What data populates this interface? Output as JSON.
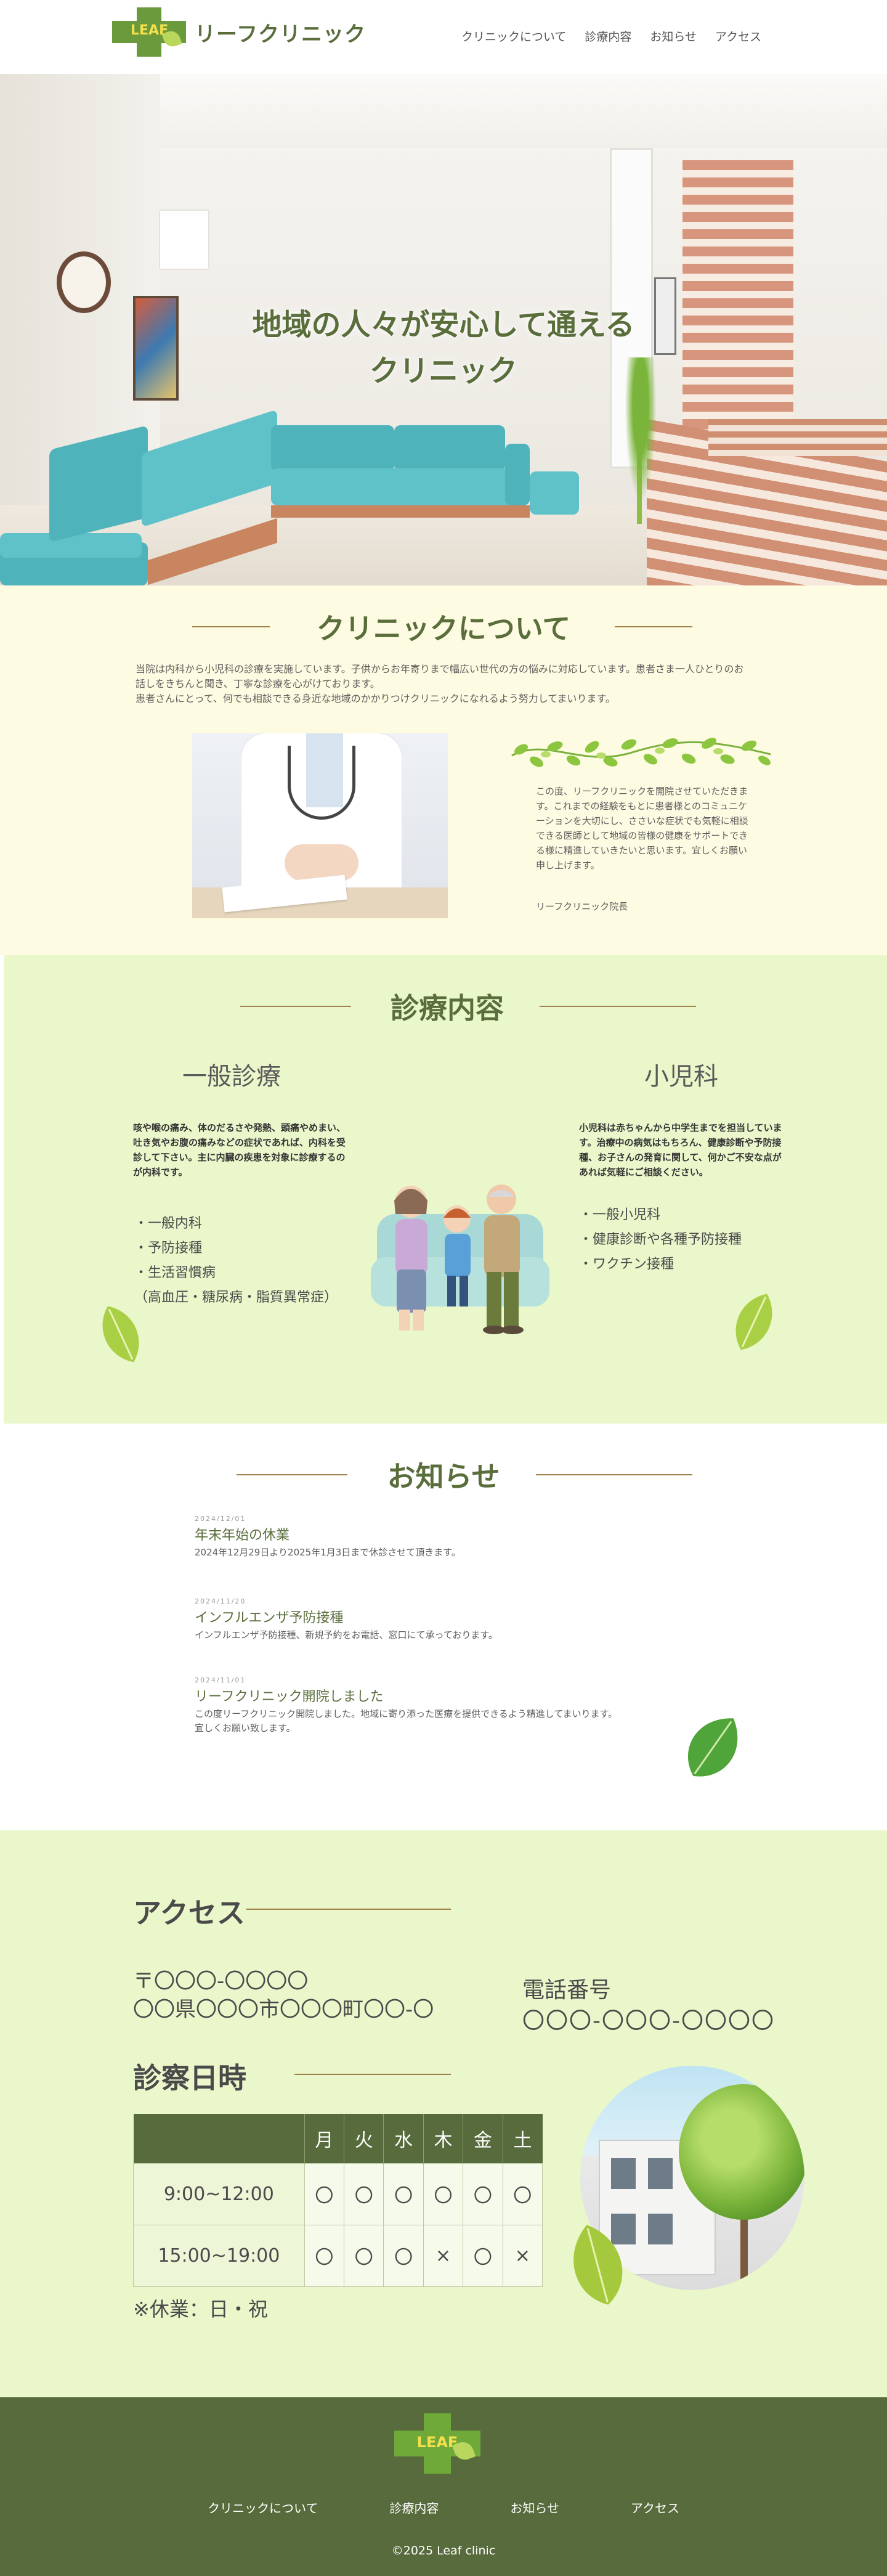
{
  "header": {
    "logo_mark": "LEAF",
    "brand": "リーフクリニック",
    "nav": [
      "クリニックについて",
      "診療内容",
      "お知らせ",
      "アクセス"
    ]
  },
  "hero": {
    "title_line1": "地域の人々が安心して通える",
    "title_line2": "クリニック"
  },
  "about": {
    "title": "クリニックについて",
    "lead": "当院は内科から小児科の診療を実施しています。子供からお年寄りまで幅広い世代の方の悩みに対応しています。患者さま一人ひとりのお話しをきちんと聞き、丁寧な診療を心がけております。\n患者さんにとって、何でも相談できる身近な地域のかかりつけクリニックになれるよう努力してまいります。",
    "greeting": "この度、リーフクリニックを開院させていただきます。これまでの経験をもとに患者様とのコミュニケーションを大切にし、ささいな症状でも気軽に相談できる医師として地域の皆様の健康をサポートできる様に精進していきたいと思います。宜しくお願い申し上げます。",
    "signature": "リーフクリニック院長"
  },
  "services": {
    "title": "診療内容",
    "general": {
      "heading": "一般診療",
      "description": "咳や喉の痛み、体のだるさや発熱、頭痛やめまい、吐き気やお腹の痛みなどの症状であれば、内科を受診して下さい。主に内臓の疾患を対象に診療するのが内科です。",
      "items": [
        "・一般内科",
        "・予防接種",
        "・生活習慣病",
        "（高血圧・糖尿病・脂質異常症）"
      ]
    },
    "pediatrics": {
      "heading": "小児科",
      "description": "小児科は赤ちゃんから中学生までを担当しています。治療中の病気はもちろん、健康診断や予防接種、お子さんの発育に関して、何かご不安な点があれば気軽にご相談ください。",
      "items": [
        "・一般小児科",
        "・健康診断や各種予防接種",
        "・ワクチン接種"
      ]
    }
  },
  "news": {
    "title": "お知らせ",
    "items": [
      {
        "date": "2024/12/01",
        "title": "年末年始の休業",
        "body": "2024年12月29日より2025年1月3日まで休診させて頂きます。"
      },
      {
        "date": "2024/11/20",
        "title": "インフルエンザ予防接種",
        "body": "インフルエンザ予防接種、新規予約をお電話、窓口にて承っております。"
      },
      {
        "date": "2024/11/01",
        "title": "リーフクリニック開院しました",
        "body": "この度リーフクリニック開院しました。地域に寄り添った医療を提供できるよう精進してまいります。\n宜しくお願い致します。"
      }
    ]
  },
  "access": {
    "title": "アクセス",
    "postal": "〒〇〇〇-〇〇〇〇",
    "address": "〇〇県〇〇〇市〇〇〇町〇〇-〇",
    "tel_label": "電話番号",
    "tel": "〇〇〇-〇〇〇-〇〇〇〇"
  },
  "schedule": {
    "title": "診察日時",
    "days": [
      "月",
      "火",
      "水",
      "木",
      "金",
      "土"
    ],
    "rows": [
      {
        "time": "9:00~12:00",
        "marks": [
          "〇",
          "〇",
          "〇",
          "〇",
          "〇",
          "〇"
        ]
      },
      {
        "time": "15:00~19:00",
        "marks": [
          "〇",
          "〇",
          "〇",
          "×",
          "〇",
          "×"
        ]
      }
    ],
    "holiday": "※休業：日・祝"
  },
  "footer": {
    "logo_mark": "LEAF",
    "nav": [
      "クリニックについて",
      "診療内容",
      "お知らせ",
      "アクセス"
    ],
    "copyright": "©2025 Leaf clinic"
  },
  "colors": {
    "brand_green": "#5a6e3c",
    "logo_green": "#6a9a3c",
    "about_bg": "#fdfbe1",
    "section_bg": "#eaf7cb",
    "accent_line": "#a0824a",
    "footer_bg": "#586b3c"
  }
}
